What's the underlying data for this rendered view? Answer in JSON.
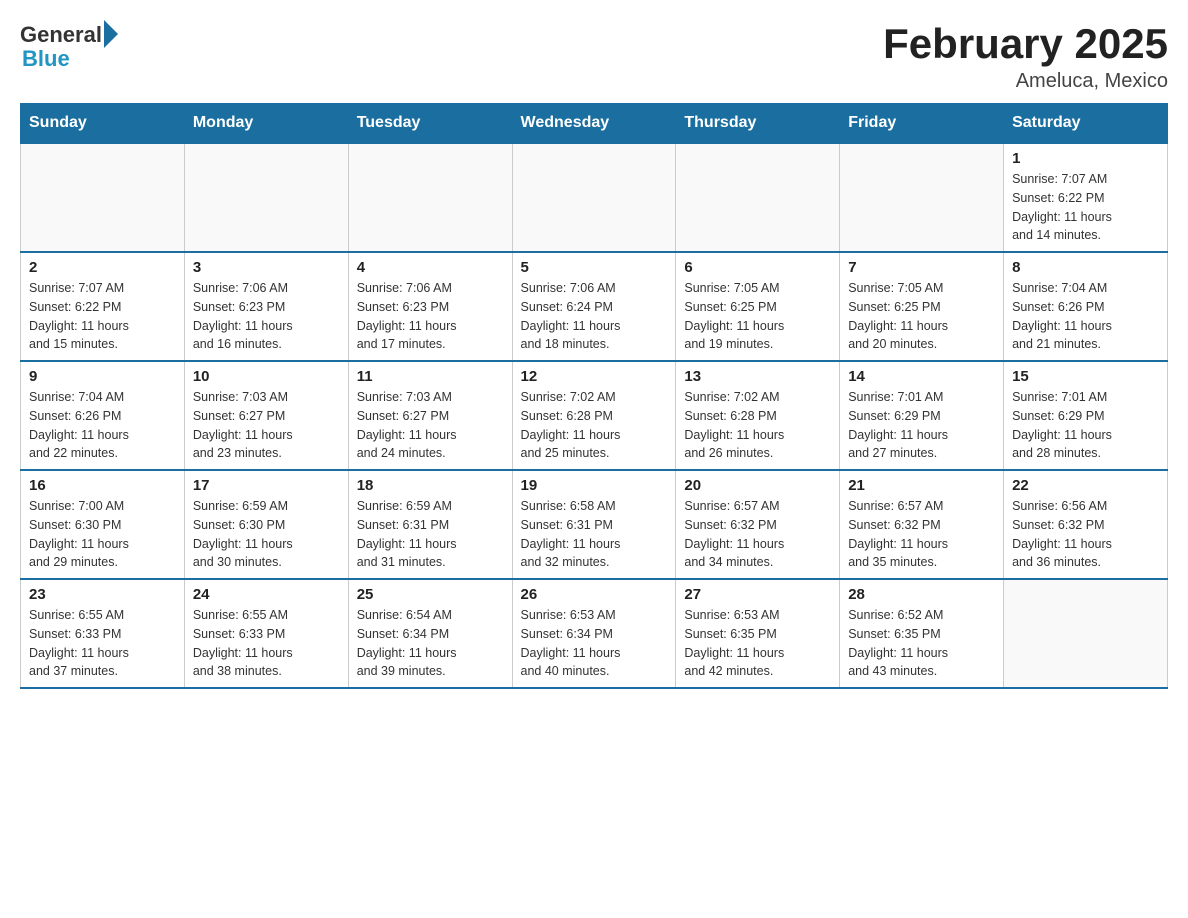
{
  "logo": {
    "general": "General",
    "blue": "Blue"
  },
  "title": "February 2025",
  "location": "Ameluca, Mexico",
  "days_header": [
    "Sunday",
    "Monday",
    "Tuesday",
    "Wednesday",
    "Thursday",
    "Friday",
    "Saturday"
  ],
  "weeks": [
    [
      {
        "day": "",
        "info": ""
      },
      {
        "day": "",
        "info": ""
      },
      {
        "day": "",
        "info": ""
      },
      {
        "day": "",
        "info": ""
      },
      {
        "day": "",
        "info": ""
      },
      {
        "day": "",
        "info": ""
      },
      {
        "day": "1",
        "info": "Sunrise: 7:07 AM\nSunset: 6:22 PM\nDaylight: 11 hours\nand 14 minutes."
      }
    ],
    [
      {
        "day": "2",
        "info": "Sunrise: 7:07 AM\nSunset: 6:22 PM\nDaylight: 11 hours\nand 15 minutes."
      },
      {
        "day": "3",
        "info": "Sunrise: 7:06 AM\nSunset: 6:23 PM\nDaylight: 11 hours\nand 16 minutes."
      },
      {
        "day": "4",
        "info": "Sunrise: 7:06 AM\nSunset: 6:23 PM\nDaylight: 11 hours\nand 17 minutes."
      },
      {
        "day": "5",
        "info": "Sunrise: 7:06 AM\nSunset: 6:24 PM\nDaylight: 11 hours\nand 18 minutes."
      },
      {
        "day": "6",
        "info": "Sunrise: 7:05 AM\nSunset: 6:25 PM\nDaylight: 11 hours\nand 19 minutes."
      },
      {
        "day": "7",
        "info": "Sunrise: 7:05 AM\nSunset: 6:25 PM\nDaylight: 11 hours\nand 20 minutes."
      },
      {
        "day": "8",
        "info": "Sunrise: 7:04 AM\nSunset: 6:26 PM\nDaylight: 11 hours\nand 21 minutes."
      }
    ],
    [
      {
        "day": "9",
        "info": "Sunrise: 7:04 AM\nSunset: 6:26 PM\nDaylight: 11 hours\nand 22 minutes."
      },
      {
        "day": "10",
        "info": "Sunrise: 7:03 AM\nSunset: 6:27 PM\nDaylight: 11 hours\nand 23 minutes."
      },
      {
        "day": "11",
        "info": "Sunrise: 7:03 AM\nSunset: 6:27 PM\nDaylight: 11 hours\nand 24 minutes."
      },
      {
        "day": "12",
        "info": "Sunrise: 7:02 AM\nSunset: 6:28 PM\nDaylight: 11 hours\nand 25 minutes."
      },
      {
        "day": "13",
        "info": "Sunrise: 7:02 AM\nSunset: 6:28 PM\nDaylight: 11 hours\nand 26 minutes."
      },
      {
        "day": "14",
        "info": "Sunrise: 7:01 AM\nSunset: 6:29 PM\nDaylight: 11 hours\nand 27 minutes."
      },
      {
        "day": "15",
        "info": "Sunrise: 7:01 AM\nSunset: 6:29 PM\nDaylight: 11 hours\nand 28 minutes."
      }
    ],
    [
      {
        "day": "16",
        "info": "Sunrise: 7:00 AM\nSunset: 6:30 PM\nDaylight: 11 hours\nand 29 minutes."
      },
      {
        "day": "17",
        "info": "Sunrise: 6:59 AM\nSunset: 6:30 PM\nDaylight: 11 hours\nand 30 minutes."
      },
      {
        "day": "18",
        "info": "Sunrise: 6:59 AM\nSunset: 6:31 PM\nDaylight: 11 hours\nand 31 minutes."
      },
      {
        "day": "19",
        "info": "Sunrise: 6:58 AM\nSunset: 6:31 PM\nDaylight: 11 hours\nand 32 minutes."
      },
      {
        "day": "20",
        "info": "Sunrise: 6:57 AM\nSunset: 6:32 PM\nDaylight: 11 hours\nand 34 minutes."
      },
      {
        "day": "21",
        "info": "Sunrise: 6:57 AM\nSunset: 6:32 PM\nDaylight: 11 hours\nand 35 minutes."
      },
      {
        "day": "22",
        "info": "Sunrise: 6:56 AM\nSunset: 6:32 PM\nDaylight: 11 hours\nand 36 minutes."
      }
    ],
    [
      {
        "day": "23",
        "info": "Sunrise: 6:55 AM\nSunset: 6:33 PM\nDaylight: 11 hours\nand 37 minutes."
      },
      {
        "day": "24",
        "info": "Sunrise: 6:55 AM\nSunset: 6:33 PM\nDaylight: 11 hours\nand 38 minutes."
      },
      {
        "day": "25",
        "info": "Sunrise: 6:54 AM\nSunset: 6:34 PM\nDaylight: 11 hours\nand 39 minutes."
      },
      {
        "day": "26",
        "info": "Sunrise: 6:53 AM\nSunset: 6:34 PM\nDaylight: 11 hours\nand 40 minutes."
      },
      {
        "day": "27",
        "info": "Sunrise: 6:53 AM\nSunset: 6:35 PM\nDaylight: 11 hours\nand 42 minutes."
      },
      {
        "day": "28",
        "info": "Sunrise: 6:52 AM\nSunset: 6:35 PM\nDaylight: 11 hours\nand 43 minutes."
      },
      {
        "day": "",
        "info": ""
      }
    ]
  ]
}
